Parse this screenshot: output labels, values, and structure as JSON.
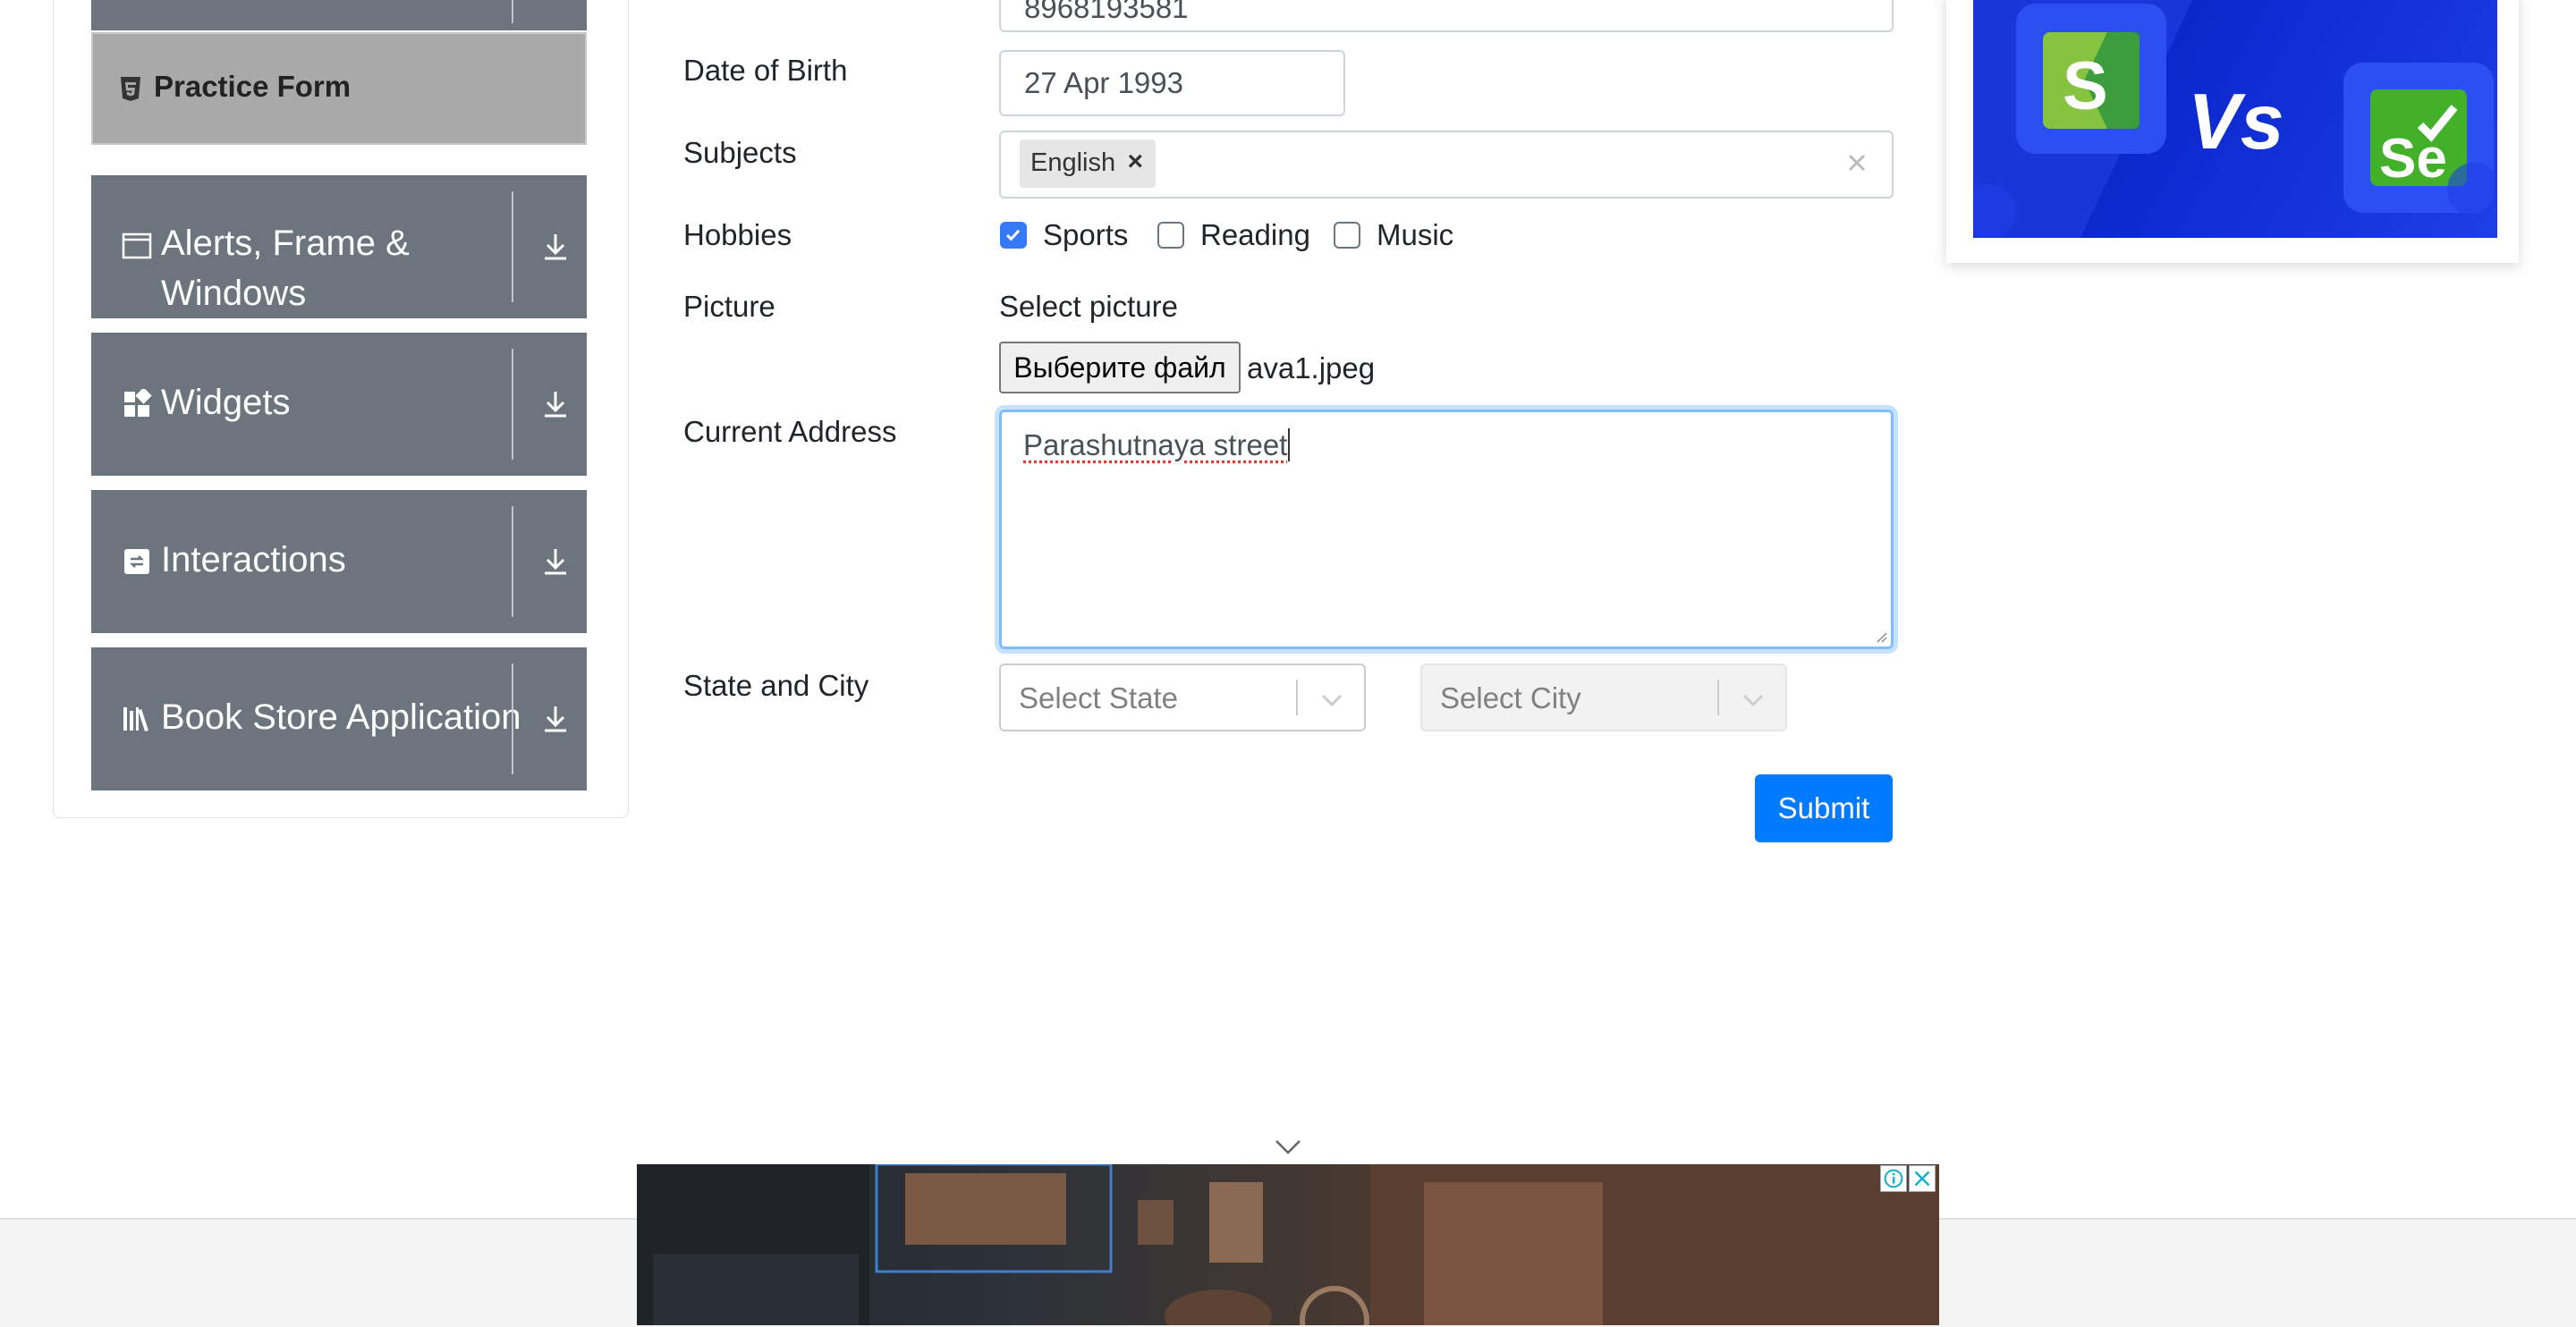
{
  "sidebar": {
    "practice_form": "Practice Form",
    "groups": [
      {
        "label": "Alerts, Frame & Windows",
        "icon": "window-icon"
      },
      {
        "label": "Widgets",
        "icon": "widgets-icon"
      },
      {
        "label": "Interactions",
        "icon": "interactions-icon"
      },
      {
        "label": "Book Store Application",
        "icon": "books-icon"
      }
    ]
  },
  "form": {
    "mobile_value": "8968193581",
    "dob_label": "Date of Birth",
    "dob_value": "27 Apr 1993",
    "subjects_label": "Subjects",
    "subject_chip": "English",
    "hobbies_label": "Hobbies",
    "hobbies": [
      {
        "label": "Sports",
        "checked": true
      },
      {
        "label": "Reading",
        "checked": false
      },
      {
        "label": "Music",
        "checked": false
      }
    ],
    "picture_label": "Picture",
    "select_picture": "Select picture",
    "file_button": "Выберите файл",
    "file_name": "ava1.jpeg",
    "address_label": "Current Address",
    "address_value": "Parashutnaya street",
    "state_city_label": "State and City",
    "state_placeholder": "Select State",
    "city_placeholder": "Select City",
    "submit": "Submit"
  },
  "ad_right": {
    "left_logo_letter": "S",
    "vs_text": "Vs",
    "right_logo_text": "Se"
  },
  "colors": {
    "primary": "#007bff",
    "sidebar_bg": "#6c757d",
    "active_bg": "#a9a9a9"
  }
}
